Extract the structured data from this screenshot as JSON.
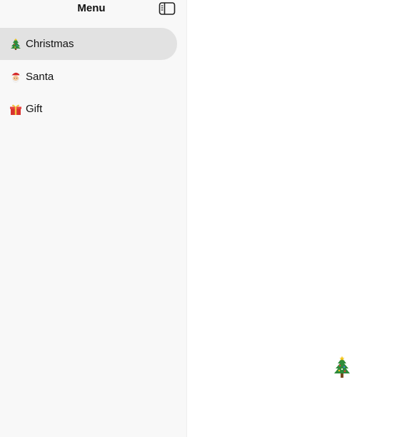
{
  "sidebar": {
    "title": "Menu",
    "toggle_icon": "sidebar-toggle-icon",
    "items": [
      {
        "label": "Christmas",
        "icon": "christmas-tree-icon",
        "active": true
      },
      {
        "label": "Santa",
        "icon": "santa-icon",
        "active": false
      },
      {
        "label": "Gift",
        "icon": "gift-icon",
        "active": false
      }
    ]
  },
  "main": {
    "icon": "christmas-tree-icon"
  },
  "colors": {
    "sidebar_bg": "#f8f8f8",
    "active_item_bg": "#e2e2e2",
    "main_bg": "#ffffff"
  }
}
